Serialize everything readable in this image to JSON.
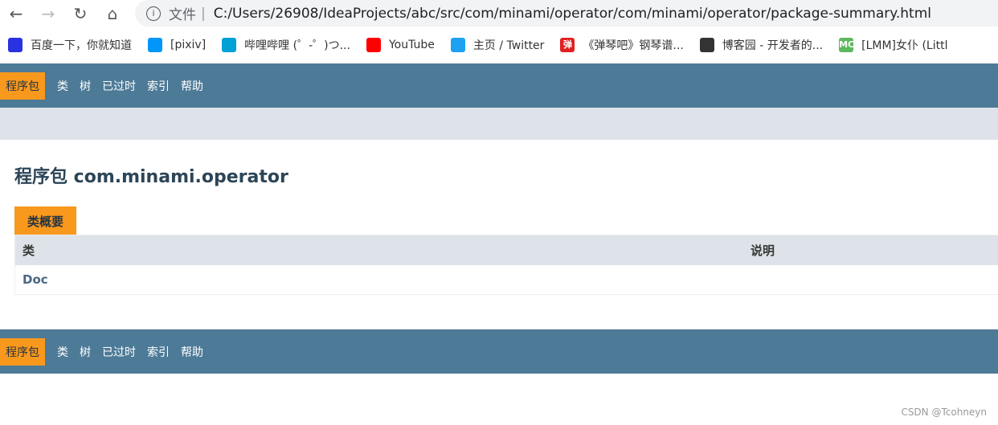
{
  "browser": {
    "url_prefix": "文件",
    "url": "C:/Users/26908/IdeaProjects/abc/src/com/minami/operator/com/minami/operator/package-summary.html",
    "bookmarks": [
      {
        "label": "百度一下，你就知道",
        "icon": "baidu-icon",
        "color": "#2932e1"
      },
      {
        "label": "[pixiv]",
        "icon": "pixiv-icon",
        "color": "#0096fa"
      },
      {
        "label": "哔哩哔哩 (゜-゜)つ...",
        "icon": "bilibili-icon",
        "color": "#00a1d6"
      },
      {
        "label": "YouTube",
        "icon": "youtube-icon",
        "color": "#ff0000"
      },
      {
        "label": "主页 / Twitter",
        "icon": "twitter-icon",
        "color": "#1da1f2"
      },
      {
        "label": "《弹琴吧》钢琴谱...",
        "icon": "tanqinba-icon",
        "color": "#e02020",
        "glyph": "弹"
      },
      {
        "label": "博客园 - 开发者的...",
        "icon": "cnblogs-icon",
        "color": "#333333"
      },
      {
        "label": "[LMM]女仆 (Littl",
        "icon": "mc-icon",
        "color": "#5cb85c",
        "glyph": "MC"
      }
    ]
  },
  "nav": {
    "items": [
      "程序包",
      "类",
      "树",
      "已过时",
      "索引",
      "帮助"
    ],
    "active": "程序包"
  },
  "page": {
    "title": "程序包 com.minami.operator",
    "caption": "类概要",
    "headers": [
      "类",
      "说明"
    ],
    "rows": [
      {
        "class": "Doc",
        "desc": ""
      }
    ]
  },
  "watermark": "CSDN @Tcohneyn"
}
